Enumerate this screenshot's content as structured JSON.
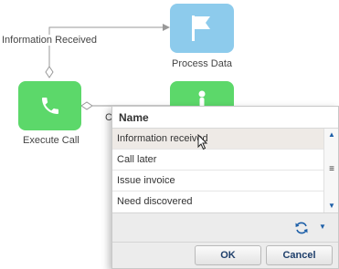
{
  "diagram": {
    "nodes": [
      {
        "id": "process-data",
        "label": "Process Data",
        "color": "#8dcbec",
        "icon": "flag-icon"
      },
      {
        "id": "execute-call",
        "label": "Execute Call",
        "color": "#5cd86a",
        "icon": "phone-icon"
      },
      {
        "id": "partial-node",
        "label": "",
        "color": "#5cd86a",
        "icon": "user-icon"
      }
    ],
    "connections": [
      {
        "from": "execute-call",
        "to": "process-data",
        "label": "Information Received"
      },
      {
        "from": "execute-call",
        "to": "partial-node",
        "label": "C"
      }
    ],
    "connector_color": "#999999"
  },
  "lookup": {
    "column_header": "Name",
    "rows": [
      {
        "label": "Information received",
        "selected": true
      },
      {
        "label": "Call later",
        "selected": false
      },
      {
        "label": "Issue invoice",
        "selected": false
      },
      {
        "label": "Need discovered",
        "selected": false
      }
    ],
    "toolbar": {
      "refresh_icon": "refresh-icon",
      "menu_icon": "chevron-down-icon"
    },
    "ok_label": "OK",
    "cancel_label": "Cancel",
    "accent_color": "#1d5fa8"
  }
}
